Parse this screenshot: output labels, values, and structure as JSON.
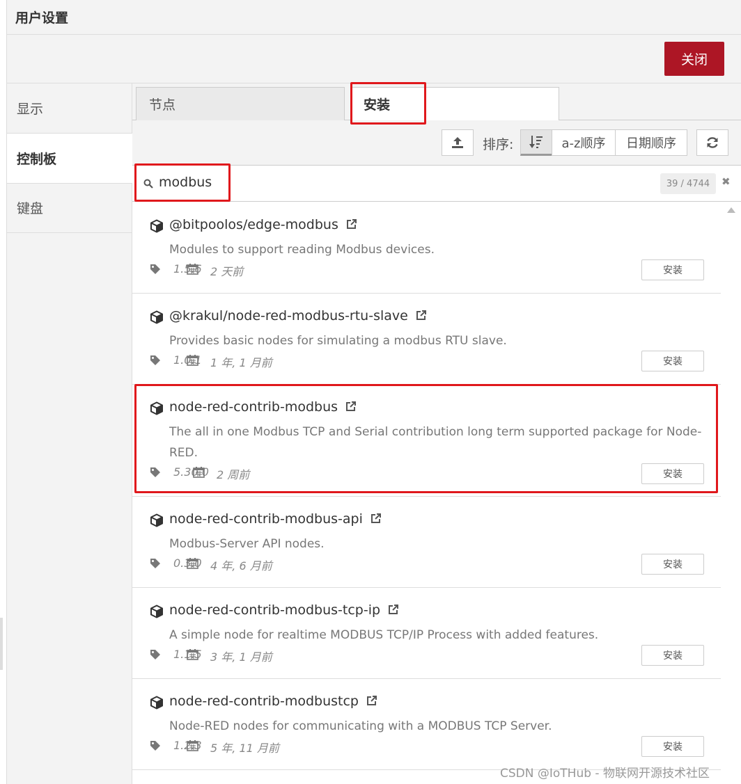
{
  "dialog": {
    "title": "用户设置",
    "close_label": "关闭"
  },
  "sidebar": {
    "items": [
      {
        "label": "显示"
      },
      {
        "label": "控制板"
      },
      {
        "label": "键盘"
      }
    ]
  },
  "tabs": [
    {
      "label": "节点"
    },
    {
      "label": "安装"
    }
  ],
  "toolbar": {
    "upload_icon": "upload-icon",
    "sort_label": "排序:",
    "sort_relevance_icon": "sort-amount-down-icon",
    "sort_az": "a-z顺序",
    "sort_date": "日期顺序",
    "refresh_icon": "refresh-icon"
  },
  "search": {
    "value": "modbus",
    "count": "39 / 4744",
    "clear_icon": "times-icon"
  },
  "packages": [
    {
      "name": "@bitpoolos/edge-modbus",
      "desc": "Modules to support reading Modbus devices.",
      "version": "1.5.6",
      "date": "2 天前",
      "install_label": "安装"
    },
    {
      "name": "@krakul/node-red-modbus-rtu-slave",
      "desc": "Provides basic nodes for simulating a modbus RTU slave.",
      "version": "1.0.1",
      "date": "1 年, 1 月前",
      "install_label": "安装"
    },
    {
      "name": "node-red-contrib-modbus",
      "desc": "The all in one Modbus TCP and Serial contribution long term supported package for Node-RED.",
      "version": "5.30.0",
      "date": "2 周前",
      "install_label": "安装"
    },
    {
      "name": "node-red-contrib-modbus-api",
      "desc": "Modbus-Server API nodes.",
      "version": "0.3.0",
      "date": "4 年, 6 月前",
      "install_label": "安装"
    },
    {
      "name": "node-red-contrib-modbus-tcp-ip",
      "desc": "A simple node for realtime MODBUS TCP/IP Process with added features.",
      "version": "1.1.5",
      "date": "3 年, 1 月前",
      "install_label": "安装"
    },
    {
      "name": "node-red-contrib-modbustcp",
      "desc": "Node-RED nodes for communicating with a MODBUS TCP Server.",
      "version": "1.2.3",
      "date": "5 年, 11 月前",
      "install_label": "安装"
    }
  ],
  "colors": {
    "accent": "#ad1625",
    "highlight": "#e0181c"
  },
  "watermark": "CSDN @IoTHub - 物联网开源技术社区"
}
